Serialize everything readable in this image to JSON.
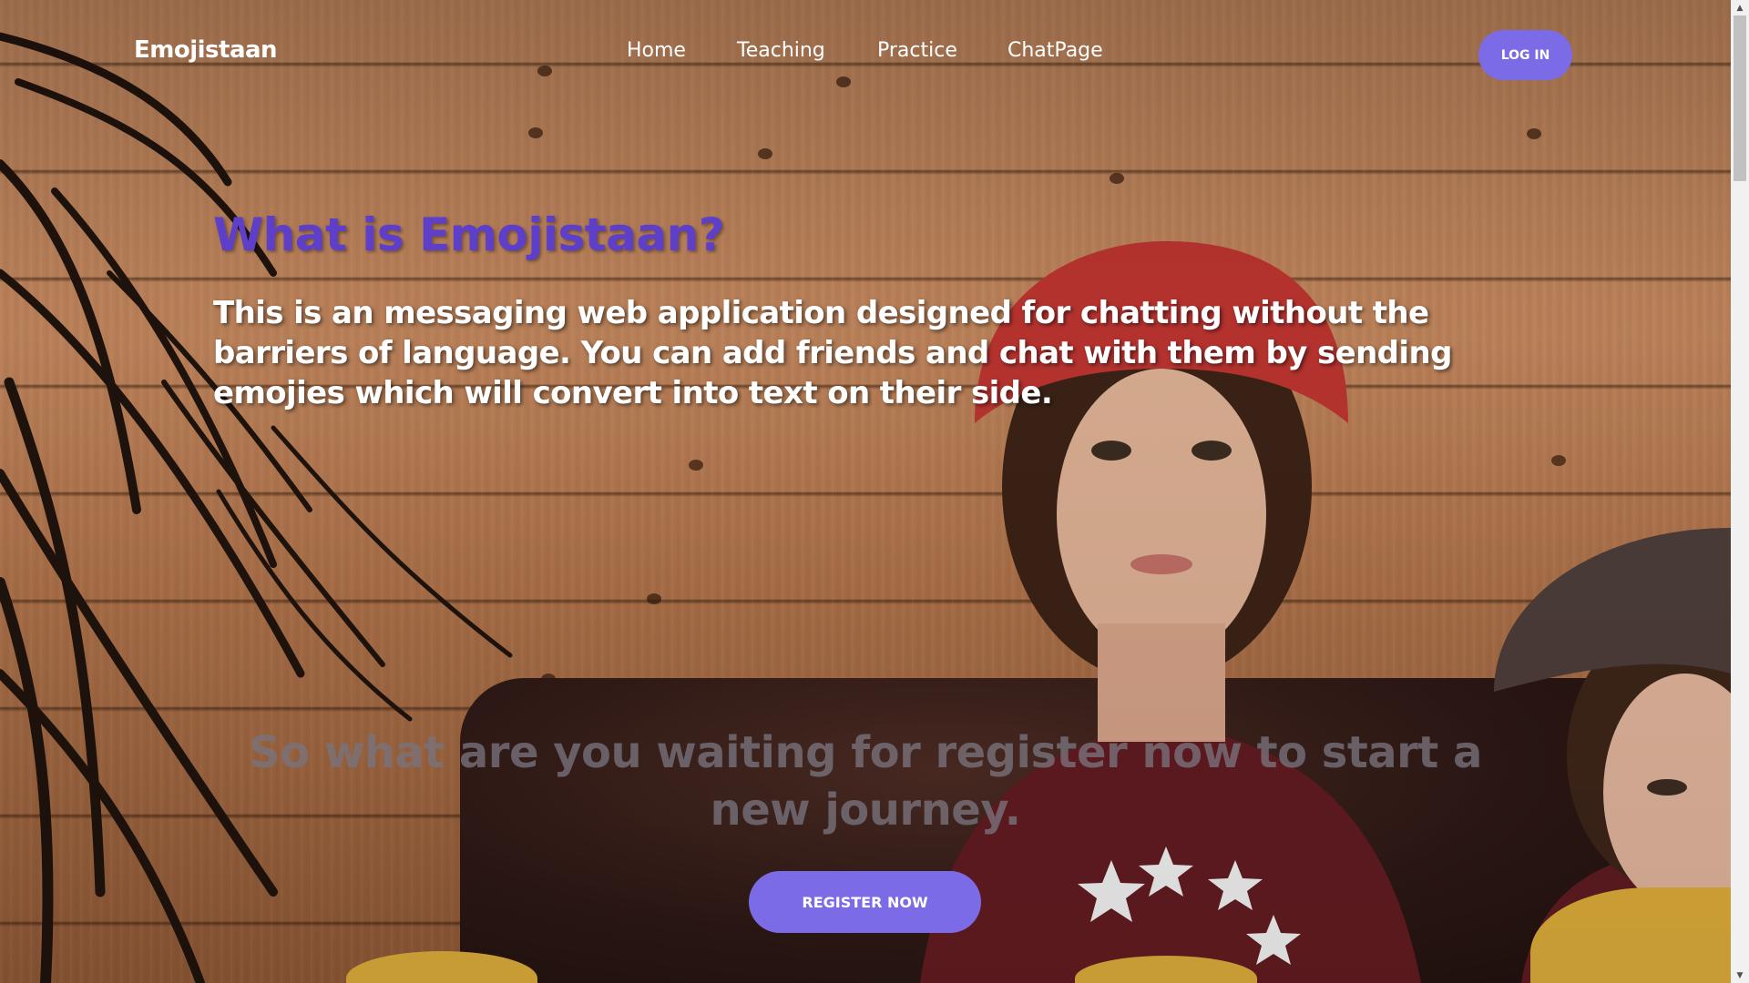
{
  "nav": {
    "brand": "Emojistaan",
    "links": [
      "Home",
      "Teaching",
      "Practice",
      "ChatPage"
    ],
    "login_label": "LOG IN"
  },
  "hero": {
    "heading": "What is Emojistaan?",
    "description": "This is an messaging web application designed for chatting without the barriers of language. You can add friends and chat with them by sending emojies which will convert into text on their side.",
    "cta_text": "So what are you waiting for register now to start a new journey.",
    "register_label": "REGISTER NOW"
  },
  "scrollbar": {
    "up_glyph": "▲",
    "down_glyph": "▼"
  },
  "colors": {
    "accent": "#7b6be6",
    "heading": "#5d3fc9",
    "text": "#ffffff",
    "muted_text": "#78737d"
  },
  "icons": {
    "scroll_up": "scroll-up-arrow-icon",
    "scroll_down": "scroll-down-arrow-icon"
  }
}
